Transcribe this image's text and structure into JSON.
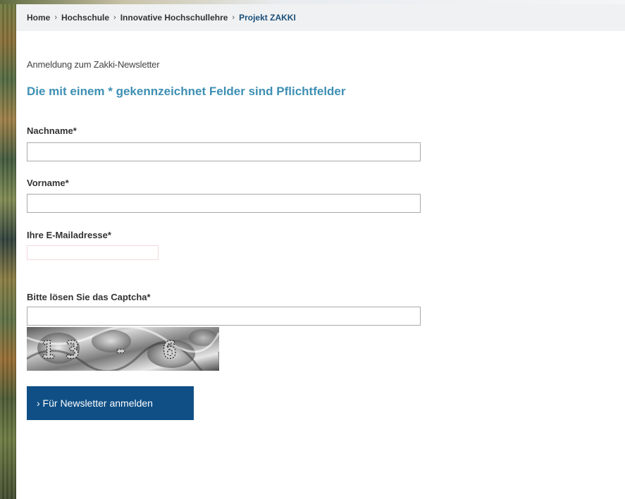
{
  "breadcrumb": {
    "items": [
      "Home",
      "Hochschule",
      "Innovative Hochschullehre"
    ],
    "current": "Projekt ZAKKI",
    "separator": "›"
  },
  "form": {
    "intro": "Anmeldung zum Zakki-Newsletter",
    "required_note": "Die mit einem * gekennzeichnet Felder sind Pflichtfelder",
    "fields": [
      {
        "label": "Nachname*",
        "value": ""
      },
      {
        "label": "Vorname*",
        "value": ""
      },
      {
        "label": "Ihre E-Mailadresse*",
        "value": ""
      },
      {
        "label": "Bitte lösen Sie das Captcha*",
        "value": ""
      }
    ],
    "captcha_text": "13 - 6",
    "submit_label": "› Für Newsletter anmelden"
  },
  "colors": {
    "accent_heading": "#3d8fb3",
    "button_bg": "#0f4f86",
    "breadcrumb_current": "#1a4f7a"
  }
}
